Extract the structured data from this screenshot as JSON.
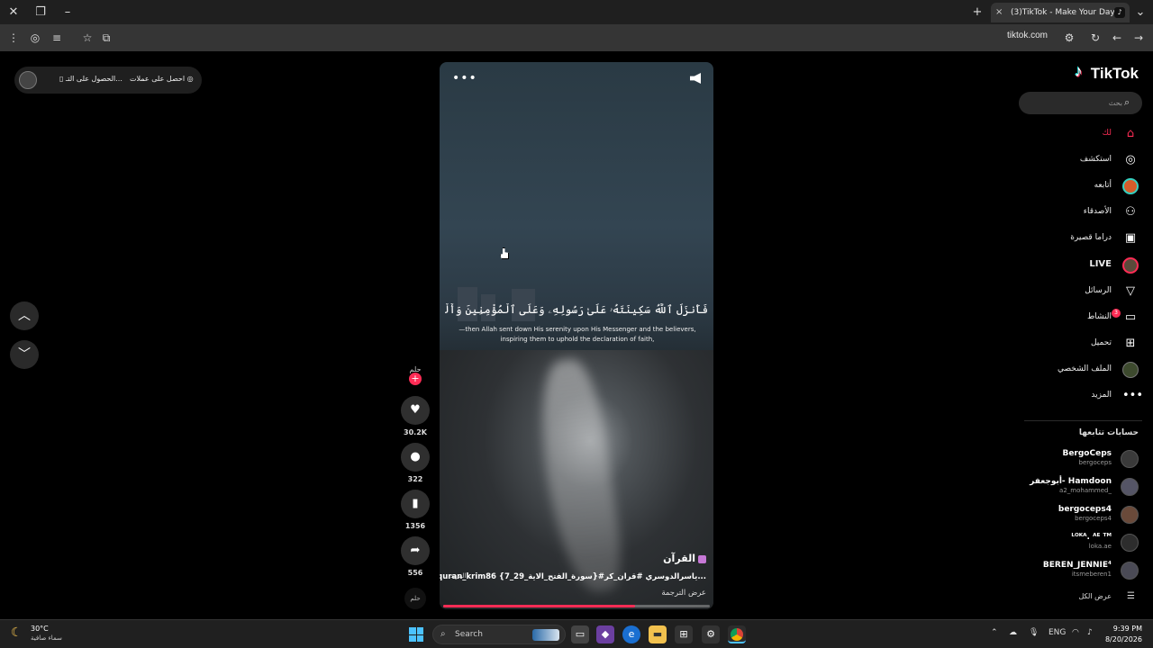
{
  "browser": {
    "tab_title": "(3)TikTok - Make Your Day",
    "url": "tiktok.com",
    "new_tab_icon": "+",
    "tab_close_icon": "×"
  },
  "get_app": {
    "btn1": "الحصول على التـ...",
    "btn2": "احصل على عملات"
  },
  "video": {
    "arabic_text": "فَأَنزَلَ ٱللَّهُ سَكِينَتَهُۥ عَلَىٰ رَسُولِهِۦ وَعَلَى ٱلْمُؤْمِنِينَ وَأَلْزَمَهُمْ كَلِمَةَ ٱلتَّقْوَىٰ",
    "translation": "—then Allah sent down His serenity upon His Messenger and the believers, inspiring them to uphold the declaration of faith,",
    "title": "القرآن",
    "tags": "#quran_krim86 {سورة_الفتح_الاية_29_7}#ياسرالدوسري #قران_كر...",
    "more_label": "المزيد",
    "translation_toggle": "عرض الترجمة",
    "progress": 0.72
  },
  "actions": {
    "likes": "30.2K",
    "comments": "322",
    "saves": "1356",
    "shares": "556"
  },
  "sidebar": {
    "logo": "TikTok",
    "search_placeholder": "بحث",
    "items": [
      {
        "label": "لك",
        "icon": "home-icon"
      },
      {
        "label": "استكشف",
        "icon": "compass-icon"
      },
      {
        "label": "أتابعه",
        "icon": "following-avatar-icon"
      },
      {
        "label": "الأصدقاء",
        "icon": "friends-icon"
      },
      {
        "label": "دراما قصيرة",
        "icon": "drama-icon"
      },
      {
        "label": "LIVE",
        "icon": "live-icon"
      },
      {
        "label": "الرسائل",
        "icon": "send-icon"
      },
      {
        "label": "النشاط",
        "icon": "activity-icon",
        "badge": "3"
      },
      {
        "label": "تحميل",
        "icon": "upload-icon"
      },
      {
        "label": "الملف الشخصي",
        "icon": "profile-icon"
      },
      {
        "label": "المزيد",
        "icon": "more-icon"
      }
    ],
    "following_title": "حسابات تتابعها",
    "following": [
      {
        "name": "BergoCeps",
        "handle": "bergoceps"
      },
      {
        "name": "أبوجعفر- Hamdoon",
        "handle": "a2_mohammed_"
      },
      {
        "name": "bergoceps4",
        "handle": "bergoceps4"
      },
      {
        "name": "ᴸᴼᴷᴬ. ᴬᴱ ᵀᴹ",
        "handle": "loka.ae"
      },
      {
        "name": "BEREN_JENNIE⁴",
        "handle": "itsmeberen1"
      }
    ],
    "see_all": "عرض الكل"
  },
  "taskbar": {
    "temp": "30°C",
    "weather_desc": "سماء صافية",
    "search_label": "Search",
    "lang": "ENG",
    "time": "9:39 PM",
    "date": "8/20/2026"
  }
}
